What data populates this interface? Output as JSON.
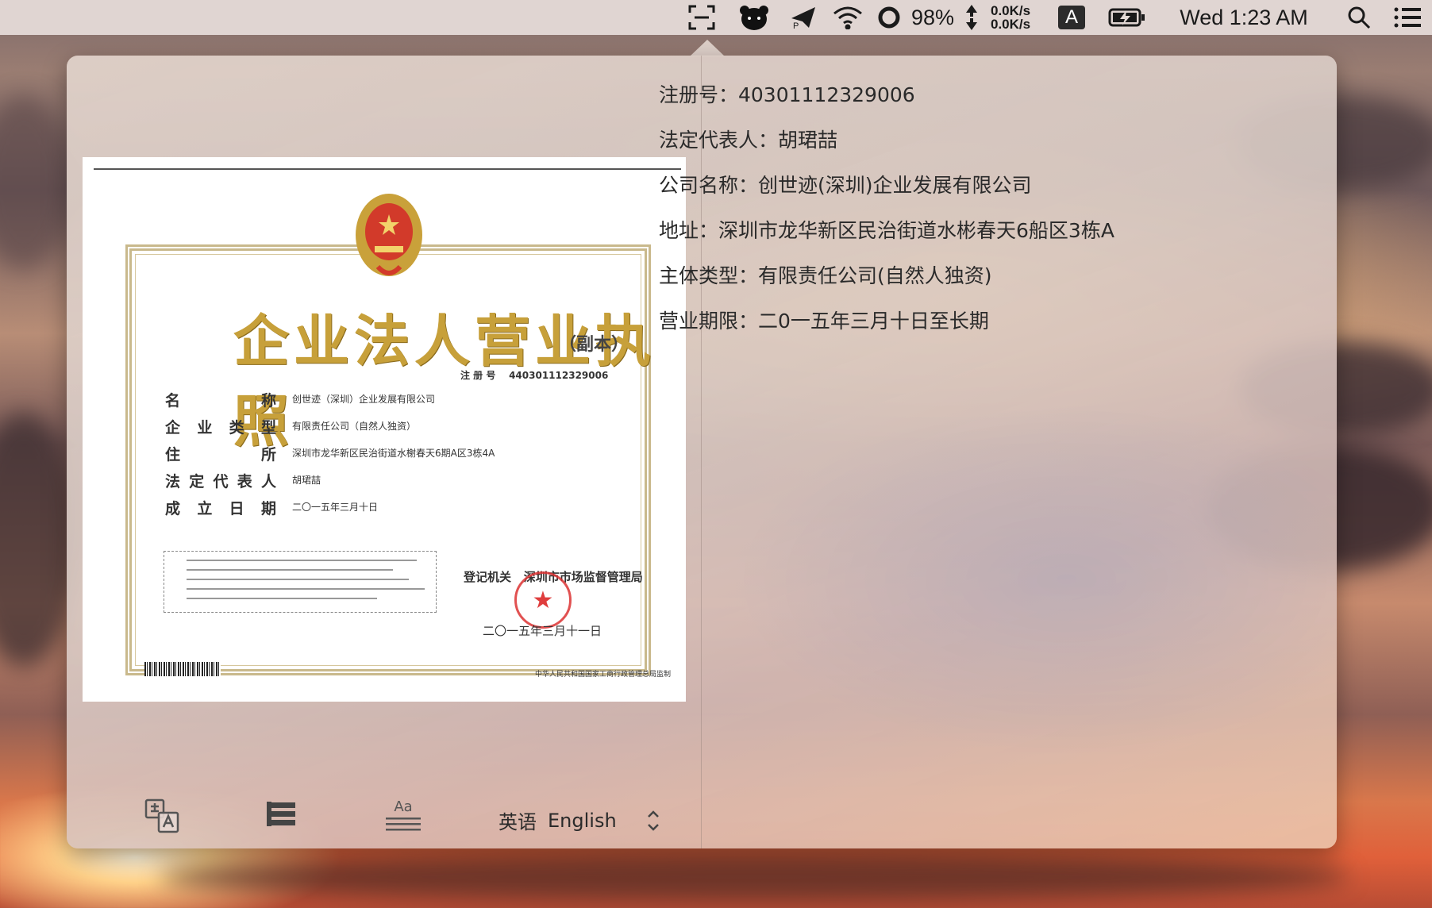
{
  "menubar": {
    "battery_percent": "98%",
    "net_up": "0.0K/s",
    "net_down": "0.0K/s",
    "input_badge": "A",
    "clock": "Wed 1:23 AM"
  },
  "certificate": {
    "title": "企业法人营业执照",
    "subtitle": "（副本）",
    "reg_label": "注 册 号",
    "reg_value": "440301112329006",
    "rows": [
      {
        "label": [
          "名",
          "称"
        ],
        "value": "创世迹（深圳）企业发展有限公司"
      },
      {
        "label": [
          "企",
          "业",
          "类",
          "型"
        ],
        "value": "有限责任公司（自然人独资）"
      },
      {
        "label": [
          "住",
          "所"
        ],
        "value": "深圳市龙华新区民治街道水榭春天6期A区3栋4A"
      },
      {
        "label": [
          "法",
          "定",
          "代",
          "表",
          "人"
        ],
        "value": "胡珺喆"
      },
      {
        "label": [
          "成",
          "立",
          "日",
          "期"
        ],
        "value": "二〇一五年三月十日"
      }
    ],
    "authority_label": "登记机关",
    "authority": "深圳市市场监督管理局",
    "issue_date": "二〇一五年三月十一日",
    "footer": "中华人民共和国国家工商行政管理总局监制"
  },
  "ocr_result": {
    "lines": [
      "注册号：40301112329006",
      "法定代表人：胡珺喆",
      "公司名称：创世迹(深圳)企业发展有限公司",
      "地址：深圳市龙华新区民治街道水彬春天6船区3栋A",
      "主体类型：有限责任公司(自然人独资)",
      "营业期限：二0一五年三月十日至长期"
    ]
  },
  "toolbar": {
    "translate_icon": "translate-icon",
    "list_icon": "list-icon",
    "font_icon": "font-icon",
    "font_icon_text": "Aa",
    "language_native": "英语",
    "language": "English"
  },
  "colors": {
    "menubar": "#e4dad6",
    "cert_title_gold": "#c7a03a",
    "seal_red": "#dc3232"
  }
}
